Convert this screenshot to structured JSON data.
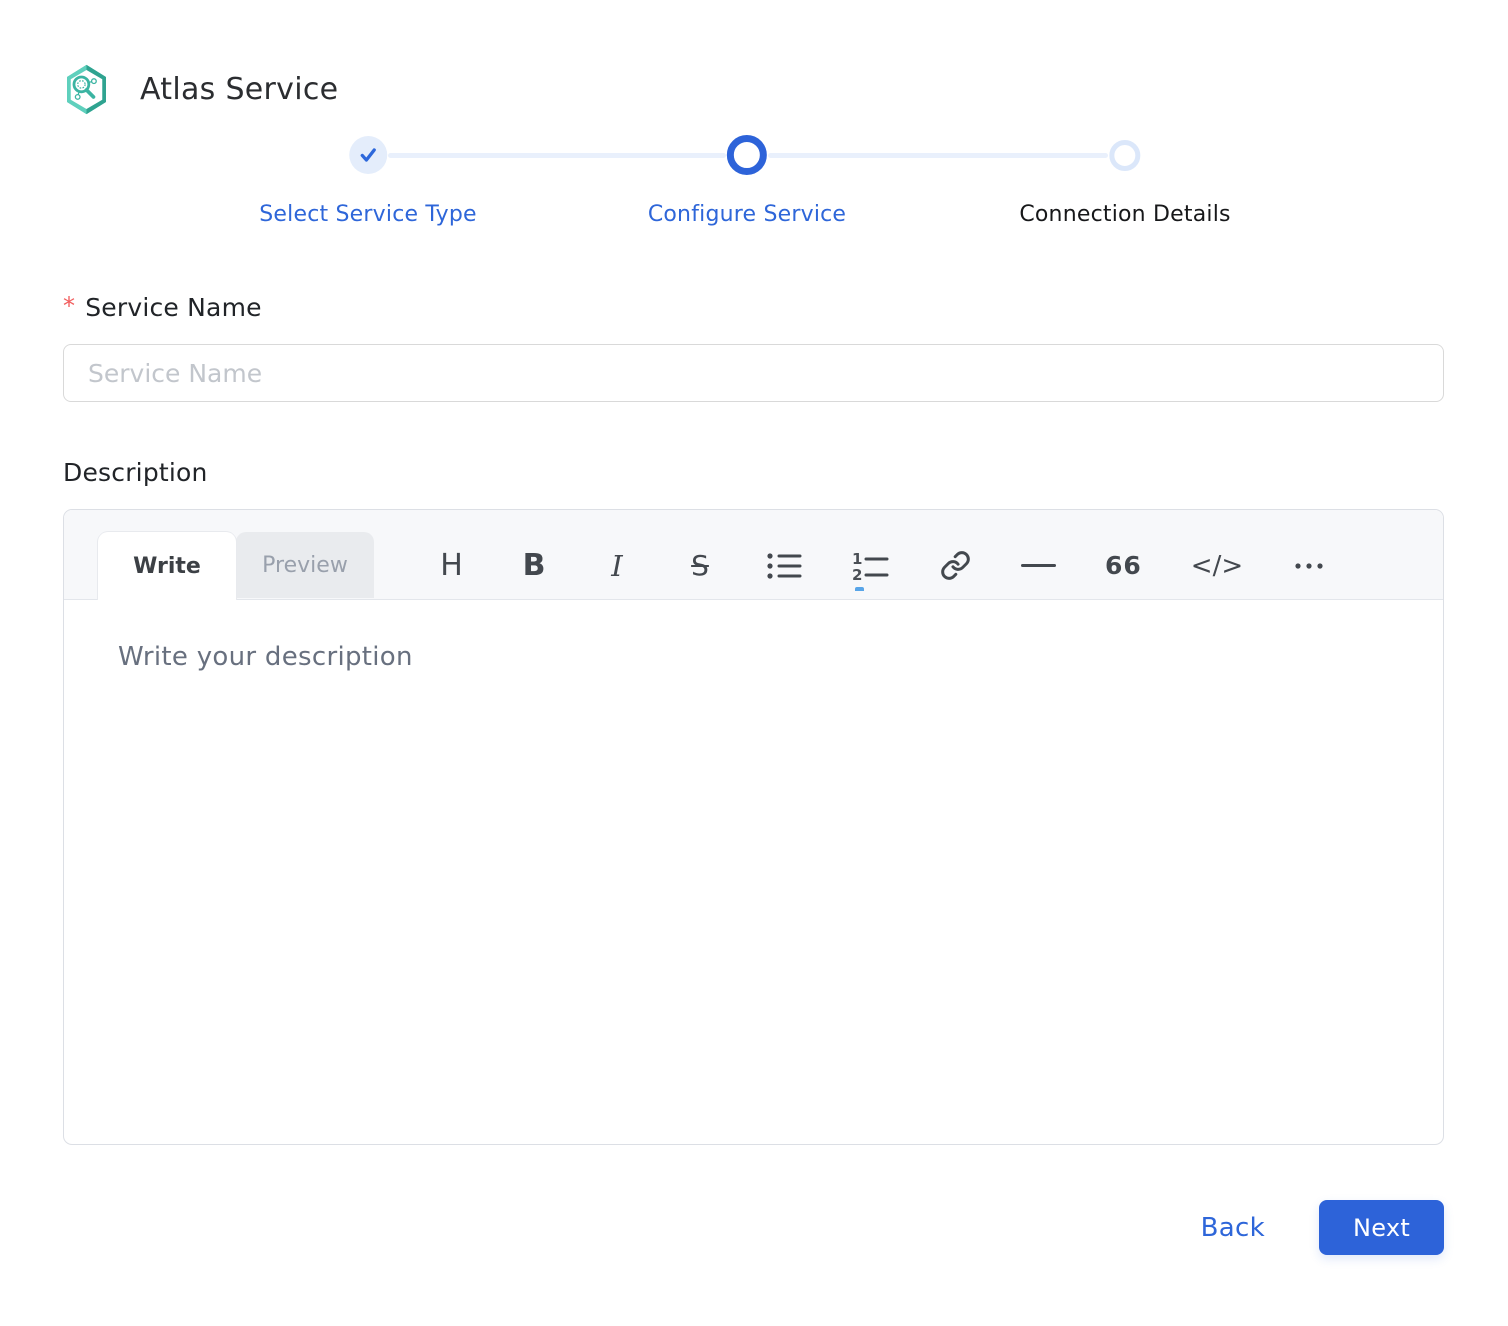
{
  "header": {
    "title": "Atlas Service"
  },
  "stepper": {
    "steps": [
      {
        "label": "Select Service Type",
        "state": "completed"
      },
      {
        "label": "Configure Service",
        "state": "active"
      },
      {
        "label": "Connection Details",
        "state": "pending"
      }
    ]
  },
  "form": {
    "service_name": {
      "label": "Service Name",
      "required_marker": "*",
      "value": "",
      "placeholder": "Service Name"
    },
    "description": {
      "label": "Description",
      "value": "",
      "placeholder": "Write your description",
      "tabs": {
        "write": "Write",
        "preview": "Preview"
      },
      "toolbar": {
        "heading": "H",
        "bold": "B",
        "italic": "I",
        "strikethrough": "S",
        "quote": "66",
        "code": "</>"
      }
    }
  },
  "footer": {
    "back": "Back",
    "next": "Next"
  },
  "colors": {
    "primary_blue": "#2d63d9",
    "step_completed_bg": "#e4edfb",
    "connector_blue": "#e9f0fc",
    "required_red": "#f15e5e",
    "logo_teal": "#45c2af",
    "logo_teal_dark": "#2fa390",
    "toolbar_bg": "#f7f8fa"
  }
}
